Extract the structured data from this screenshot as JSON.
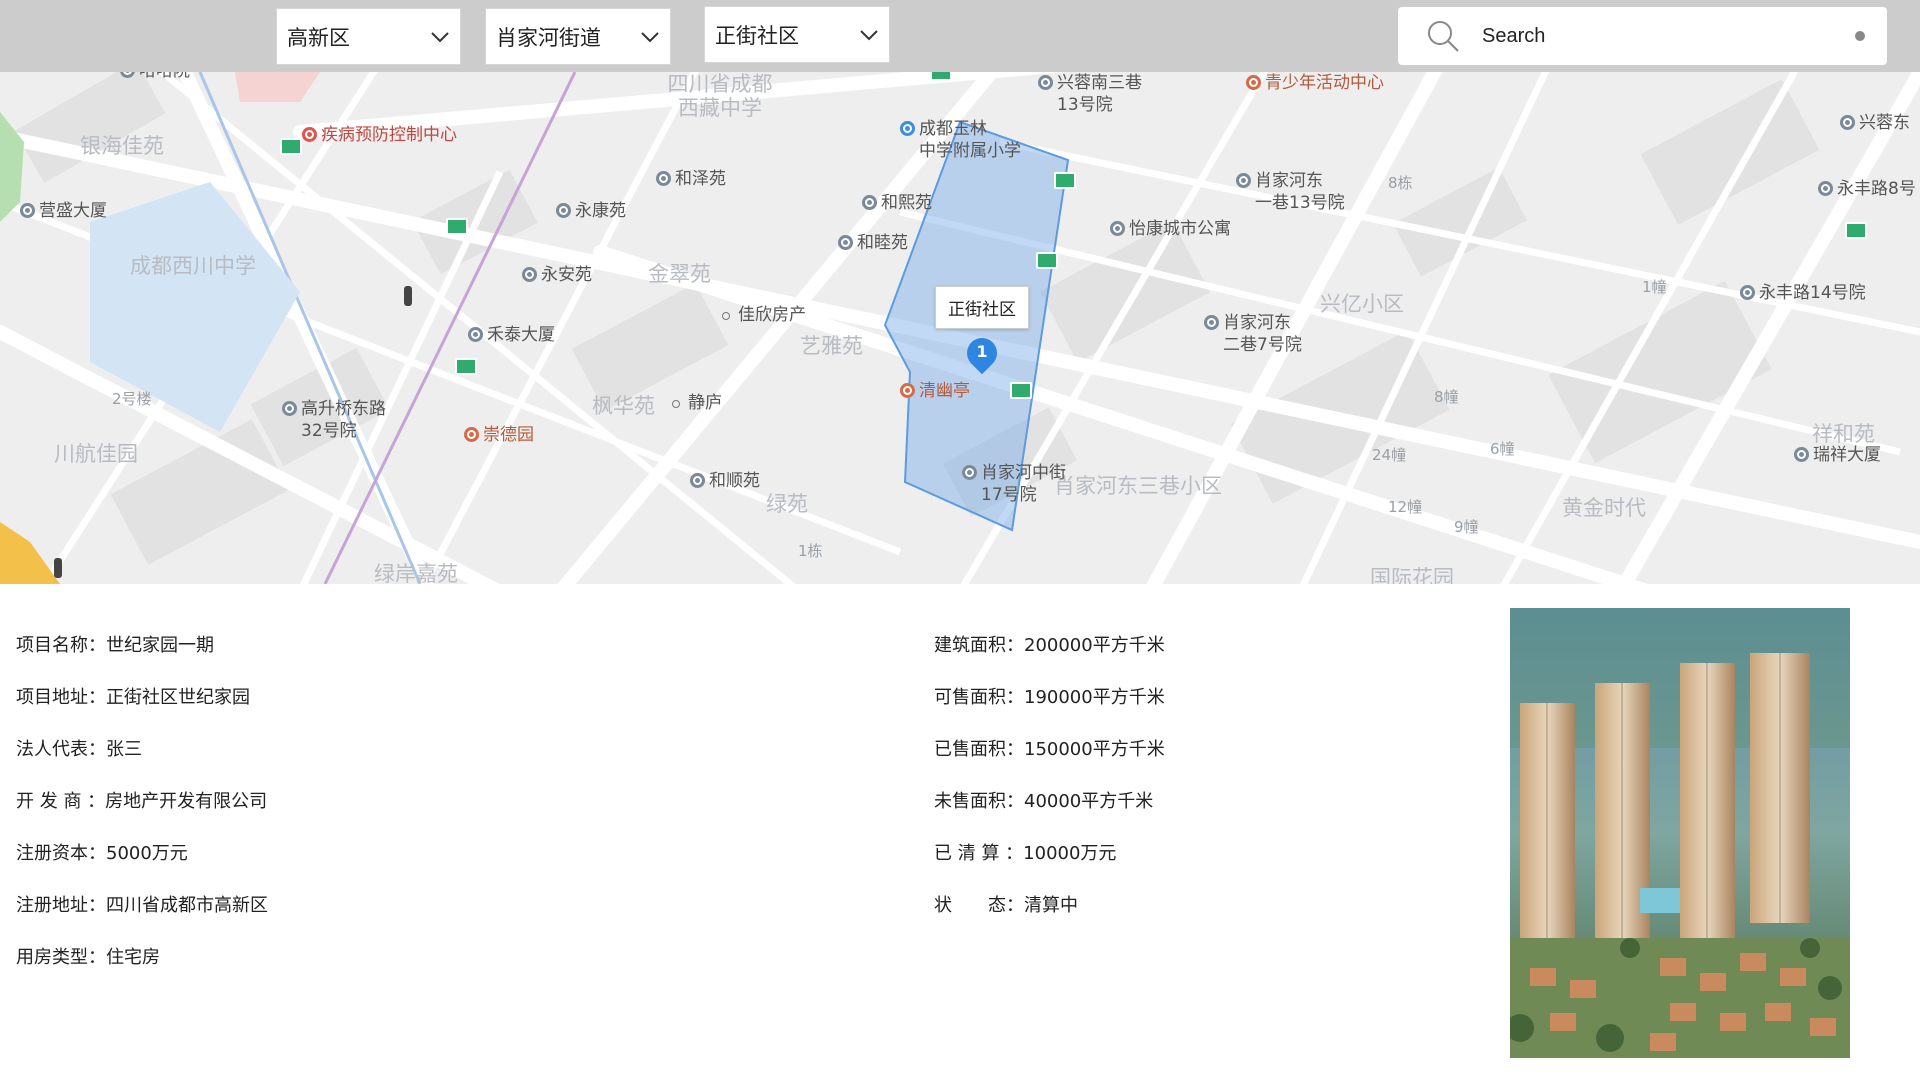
{
  "filters": {
    "district": "高新区",
    "street": "肖家河街道",
    "community": "正街社区"
  },
  "search": {
    "placeholder": "Search"
  },
  "map": {
    "callout": "正街社区",
    "marker_number": "1",
    "pois": [
      {
        "name": "疾病预防控制中心",
        "style": "red"
      },
      {
        "name": "成都玉林\n中学附属小学",
        "style": "blue"
      },
      {
        "name": "和泽苑",
        "style": "gray"
      },
      {
        "name": "永康苑",
        "style": "gray"
      },
      {
        "name": "和熙苑",
        "style": "gray"
      },
      {
        "name": "和睦苑",
        "style": "gray"
      },
      {
        "name": "营盛大厦",
        "style": "gray"
      },
      {
        "name": "永安苑",
        "style": "gray"
      },
      {
        "name": "佳欣房产",
        "style": "dot"
      },
      {
        "name": "禾泰大厦",
        "style": "gray"
      },
      {
        "name": "静庐",
        "style": "dot"
      },
      {
        "name": "清幽亭",
        "style": "orange"
      },
      {
        "name": "高升桥东路\n32号院",
        "style": "gray"
      },
      {
        "name": "崇德园",
        "style": "orange"
      },
      {
        "name": "和顺苑",
        "style": "gray"
      },
      {
        "name": "肖家河中街\n17号院",
        "style": "gray"
      },
      {
        "name": "肖家河东\n一巷13号院",
        "style": "gray"
      },
      {
        "name": "怡康城市公寓",
        "style": "gray"
      },
      {
        "name": "肖家河东\n二巷7号院",
        "style": "gray"
      },
      {
        "name": "兴蓉南三巷\n13号院",
        "style": "gray"
      },
      {
        "name": "青少年活动中心",
        "style": "orange"
      },
      {
        "name": "兴蓉东",
        "style": "gray"
      },
      {
        "name": "永丰路8号",
        "style": "gray"
      },
      {
        "name": "永丰路14号院",
        "style": "gray"
      },
      {
        "name": "瑞祥大厦",
        "style": "gray"
      },
      {
        "name": "哈哈院",
        "style": "gray"
      }
    ],
    "areas": [
      "银海佳苑",
      "四川省成都\n西藏中学",
      "成都西川中学",
      "金翠苑",
      "艺雅苑",
      "枫华苑",
      "川航佳园",
      "绿苑",
      "肖家河东三巷小区",
      "兴亿小区",
      "祥和苑",
      "黄金时代",
      "绿岸嘉苑",
      "国际花园"
    ],
    "buildings": [
      "2号楼",
      "8栋",
      "1幢",
      "8幢",
      "24幢",
      "6幢",
      "12幢",
      "9幢",
      "1栋"
    ]
  },
  "project": {
    "left": [
      {
        "label": "项目名称：",
        "value": "世纪家园一期"
      },
      {
        "label": "项目地址：",
        "value": "正街社区世纪家园"
      },
      {
        "label": "法人代表：",
        "value": "张三"
      },
      {
        "label": "开 发 商 ：",
        "value": "房地产开发有限公司"
      },
      {
        "label": "注册资本：",
        "value": "5000万元"
      },
      {
        "label": "注册地址：",
        "value": "四川省成都市高新区"
      },
      {
        "label": "用房类型：",
        "value": "住宅房"
      }
    ],
    "right": [
      {
        "label": "建筑面积：",
        "value": "200000平方千米"
      },
      {
        "label": "可售面积：",
        "value": "190000平方千米"
      },
      {
        "label": "已售面积：",
        "value": "150000平方千米"
      },
      {
        "label": "未售面积：",
        "value": "40000平方千米"
      },
      {
        "label": "已 清 算 ：",
        "value": "10000万元"
      },
      {
        "label": "状　　态：",
        "value": "清算中"
      }
    ]
  }
}
